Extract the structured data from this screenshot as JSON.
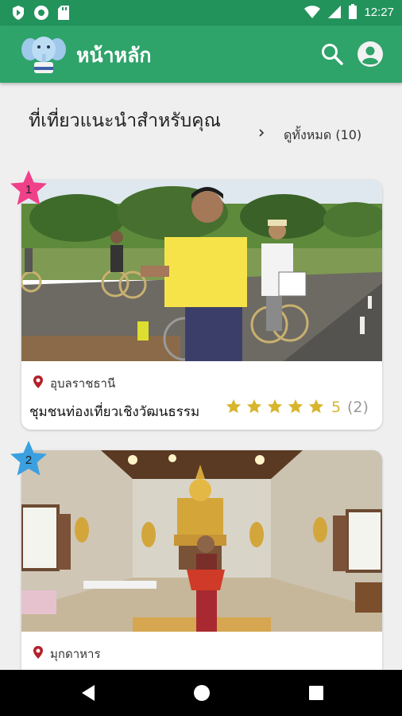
{
  "status_bar": {
    "time": "12:27"
  },
  "app_bar": {
    "title": "หน้าหลัก"
  },
  "section": {
    "title": "ที่เที่ยวแนะนำสำหรับคุณ",
    "see_all_label": "ดูทั้งหมด (10)"
  },
  "places": [
    {
      "rank": "1",
      "province": "อุบลราชธานี",
      "name": "ชุมชนท่องเที่ยวเชิงวัฒนธรรม",
      "rating": "5",
      "review_count": "(2)",
      "stars_filled": 5
    },
    {
      "rank": "2",
      "province": "มุกดาหาร"
    }
  ],
  "colors": {
    "status_bar": "#23935c",
    "app_bar": "#2ea36a",
    "star": "#d8b52e",
    "location_pin": "#b3202a",
    "badge_pink": "#f0408a",
    "badge_blue": "#3aa0e0"
  },
  "icons": {
    "search": "search-icon",
    "account": "account-circle-icon",
    "see_all": "chevron-right-icon",
    "location": "location-pin-icon",
    "rating": "star-icon"
  }
}
